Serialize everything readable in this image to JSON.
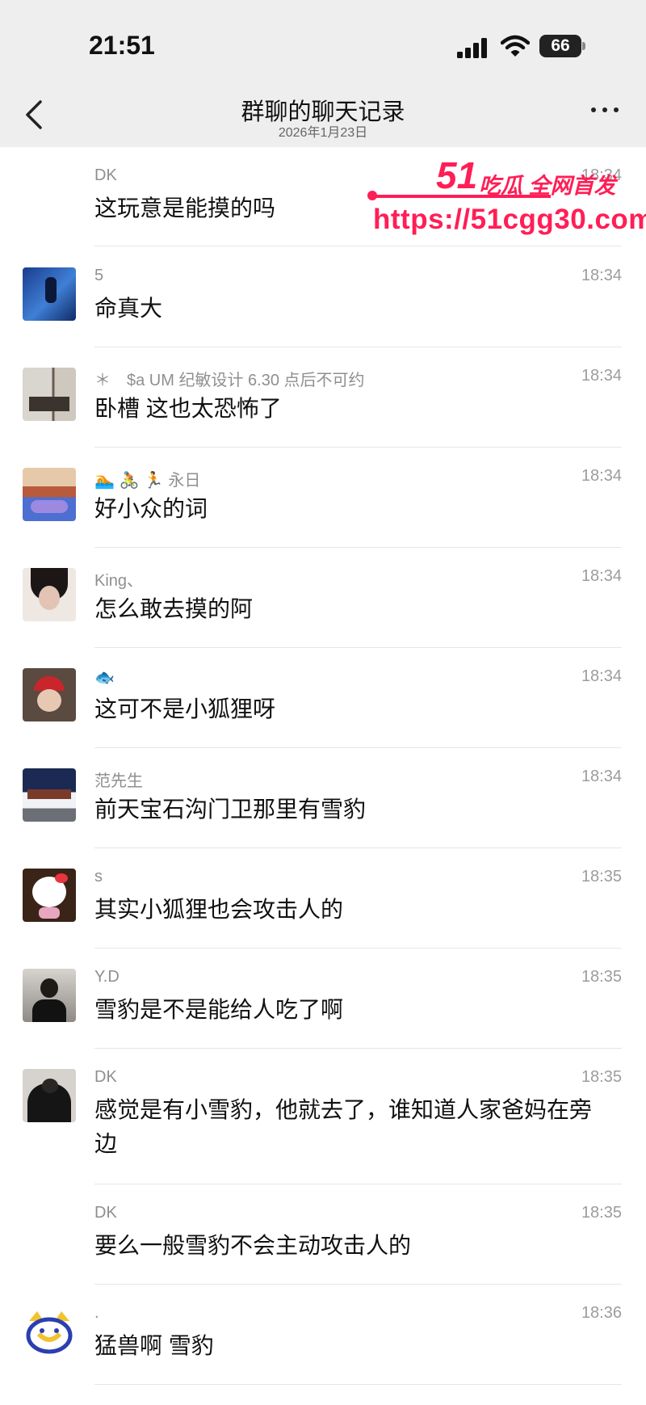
{
  "status_bar": {
    "time": "21:51",
    "battery": "66"
  },
  "nav": {
    "title": "群聊的聊天记录",
    "date": "2026年1月23日"
  },
  "watermark": {
    "brand_number": "51",
    "brand_text": "吃瓜 全网首发",
    "url": "https://51cgg30.com"
  },
  "messages": [
    {
      "name": "DK",
      "time": "18:34",
      "text": "这玩意是能摸的吗"
    },
    {
      "name": "5",
      "time": "18:34",
      "text": "命真大"
    },
    {
      "name": "＊　$a UM 纪敏设计 6.30 点后不可约",
      "time": "18:34",
      "text": "卧槽 这也太恐怖了"
    },
    {
      "name": "🏊 🚴 🏃 永日",
      "time": "18:34",
      "text": "好小众的词"
    },
    {
      "name": "King、",
      "time": "18:34",
      "text": "怎么敢去摸的阿"
    },
    {
      "name": "🐟",
      "time": "18:34",
      "text": "这可不是小狐狸呀"
    },
    {
      "name": "范先生",
      "time": "18:34",
      "text": "前天宝石沟门卫那里有雪豹"
    },
    {
      "name": "s",
      "time": "18:35",
      "text": "其实小狐狸也会攻击人的"
    },
    {
      "name": "Y.D",
      "time": "18:35",
      "text": "雪豹是不是能给人吃了啊"
    },
    {
      "name": "DK",
      "time": "18:35",
      "text": "感觉是有小雪豹，他就去了，谁知道人家爸妈在旁边"
    },
    {
      "name": "DK",
      "time": "18:35",
      "text": "要么一般雪豹不会主动攻击人的"
    },
    {
      "name": ".",
      "time": "18:36",
      "text": "猛兽啊 雪豹"
    }
  ],
  "colors": {
    "header_bg": "#eeeeee",
    "watermark": "#ff1e56",
    "name_text": "#8f8f8f",
    "time_text": "#9c9c9c"
  }
}
